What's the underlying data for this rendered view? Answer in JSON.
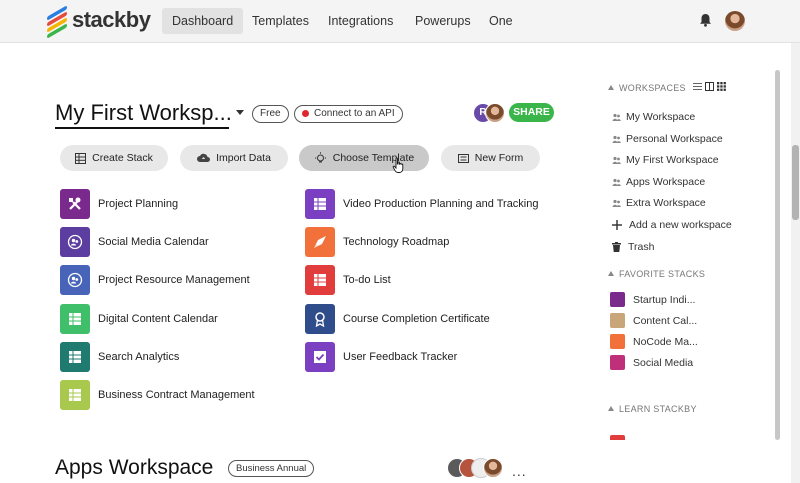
{
  "nav": {
    "logo": "stackby",
    "items": [
      "Dashboard",
      "Templates",
      "Integrations",
      "Powerups",
      "One"
    ]
  },
  "workspace": {
    "title": "My First Worksp...",
    "plan": "Free",
    "connect": "Connect to an API",
    "member_initial": "R",
    "share": "SHARE"
  },
  "actions": [
    "Create Stack",
    "Import Data",
    "Choose Template",
    "New Form"
  ],
  "templates": {
    "left": [
      {
        "label": "Project Planning",
        "color": "#7a2a8c",
        "icon": "tools-icon"
      },
      {
        "label": "Social Media Calendar",
        "color": "#5c3ea0",
        "icon": "people-icon"
      },
      {
        "label": "Project Resource Management",
        "color": "#4864b8",
        "icon": "people-icon"
      },
      {
        "label": "Digital Content Calendar",
        "color": "#3fbf6a",
        "icon": "table-icon"
      },
      {
        "label": "Search Analytics",
        "color": "#1f7a70",
        "icon": "table-icon"
      },
      {
        "label": "Business Contract Management",
        "color": "#a9c94e",
        "icon": "table-icon"
      }
    ],
    "right": [
      {
        "label": "Video Production Planning and Tracking",
        "color": "#7b3fc2",
        "icon": "table-icon"
      },
      {
        "label": "Technology Roadmap",
        "color": "#f2703a",
        "icon": "rocket-icon"
      },
      {
        "label": "To-do List",
        "color": "#e23d3d",
        "icon": "table-icon"
      },
      {
        "label": "Course Completion Certificate",
        "color": "#2f4d8a",
        "icon": "badge-icon"
      },
      {
        "label": "User Feedback Tracker",
        "color": "#7b3fc2",
        "icon": "check-icon"
      }
    ]
  },
  "apps": {
    "title": "Apps Workspace",
    "plan": "Business Annual",
    "more": "..."
  },
  "sidebar": {
    "workspaces_header": "WORKSPACES",
    "workspaces": [
      "My Workspace",
      "Personal Workspace",
      "My First Workspace",
      "Apps Workspace",
      "Extra Workspace"
    ],
    "add_workspace": "Add a new workspace",
    "trash": "Trash",
    "favorites_header": "FAVORITE STACKS",
    "favorites": [
      {
        "label": "Startup Indi...",
        "color": "#7a2a8c"
      },
      {
        "label": "Content Cal...",
        "color": "#c9a57a"
      },
      {
        "label": "NoCode Ma...",
        "color": "#f2703a"
      },
      {
        "label": "Social Media",
        "color": "#c0307a"
      }
    ],
    "learn_header": "LEARN STACKBY"
  }
}
